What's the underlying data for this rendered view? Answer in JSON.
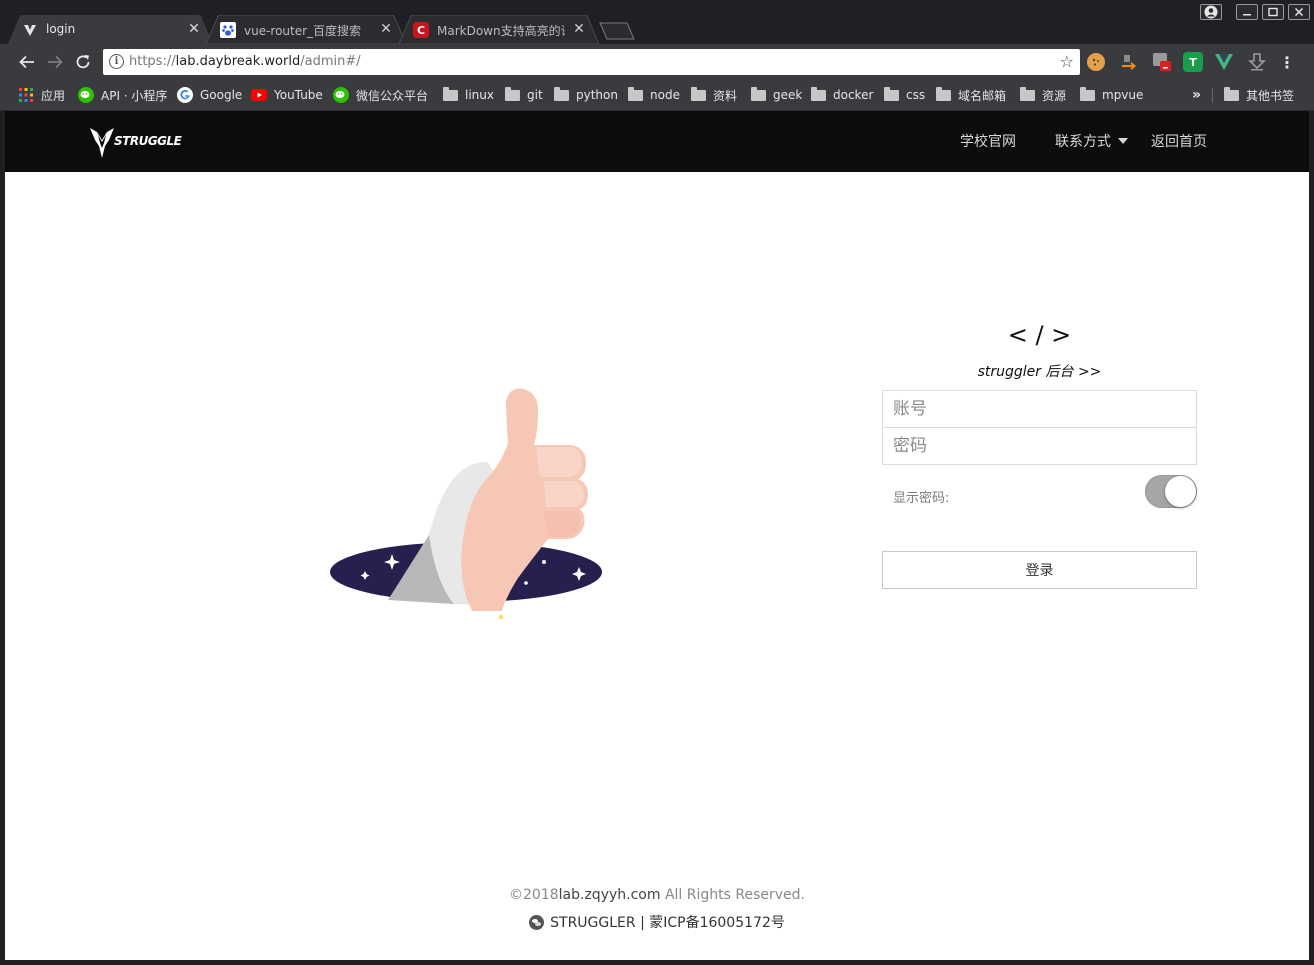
{
  "browser": {
    "tabs": [
      {
        "label": "login",
        "active": true
      },
      {
        "label": "vue-router_百度搜索",
        "active": false
      },
      {
        "label": "MarkDown支持高亮的语",
        "active": false
      }
    ],
    "url": {
      "scheme": "https://",
      "host": "lab.daybreak.world",
      "path": "/admin#/"
    },
    "bookmarks": [
      {
        "label": "应用",
        "icon": "apps-grid-icon"
      },
      {
        "label": "API · 小程序",
        "icon": "wechat-icon"
      },
      {
        "label": "Google",
        "icon": "google-icon"
      },
      {
        "label": "YouTube",
        "icon": "youtube-icon"
      },
      {
        "label": "微信公众平台",
        "icon": "wechat-icon"
      },
      {
        "label": "linux",
        "icon": "folder-icon"
      },
      {
        "label": "git",
        "icon": "folder-icon"
      },
      {
        "label": "python",
        "icon": "folder-icon"
      },
      {
        "label": "node",
        "icon": "folder-icon"
      },
      {
        "label": "资料",
        "icon": "folder-icon"
      },
      {
        "label": "geek",
        "icon": "folder-icon"
      },
      {
        "label": "docker",
        "icon": "folder-icon"
      },
      {
        "label": "css",
        "icon": "folder-icon"
      },
      {
        "label": "域名邮箱",
        "icon": "folder-icon"
      },
      {
        "label": "资源",
        "icon": "folder-icon"
      },
      {
        "label": "mpvue",
        "icon": "folder-icon"
      }
    ],
    "overflow_label": "»",
    "other_bookmarks": "其他书签"
  },
  "site": {
    "logo_text": "STRUGGLE",
    "nav": {
      "school": "学校官网",
      "contact": "联系方式",
      "home": "返回首页"
    }
  },
  "login": {
    "code_mark": "< / >",
    "subtitle": "struggler 后台 >>",
    "account_placeholder": "账号",
    "password_placeholder": "密码",
    "show_password_label": "显示密码:",
    "show_password_on": true,
    "submit_label": "登录"
  },
  "footer": {
    "copyright_prefix": "©2018",
    "domain": "lab.zqyyh.com",
    "rights": " All Rights Reserved.",
    "icp": "STRUGGLER | 蒙ICP备16005172号"
  },
  "colors": {
    "site_header": "#0b0d0b",
    "portal": "#26204f",
    "hand": "#f7c7b6",
    "sleeve": "#e8e8e8"
  }
}
